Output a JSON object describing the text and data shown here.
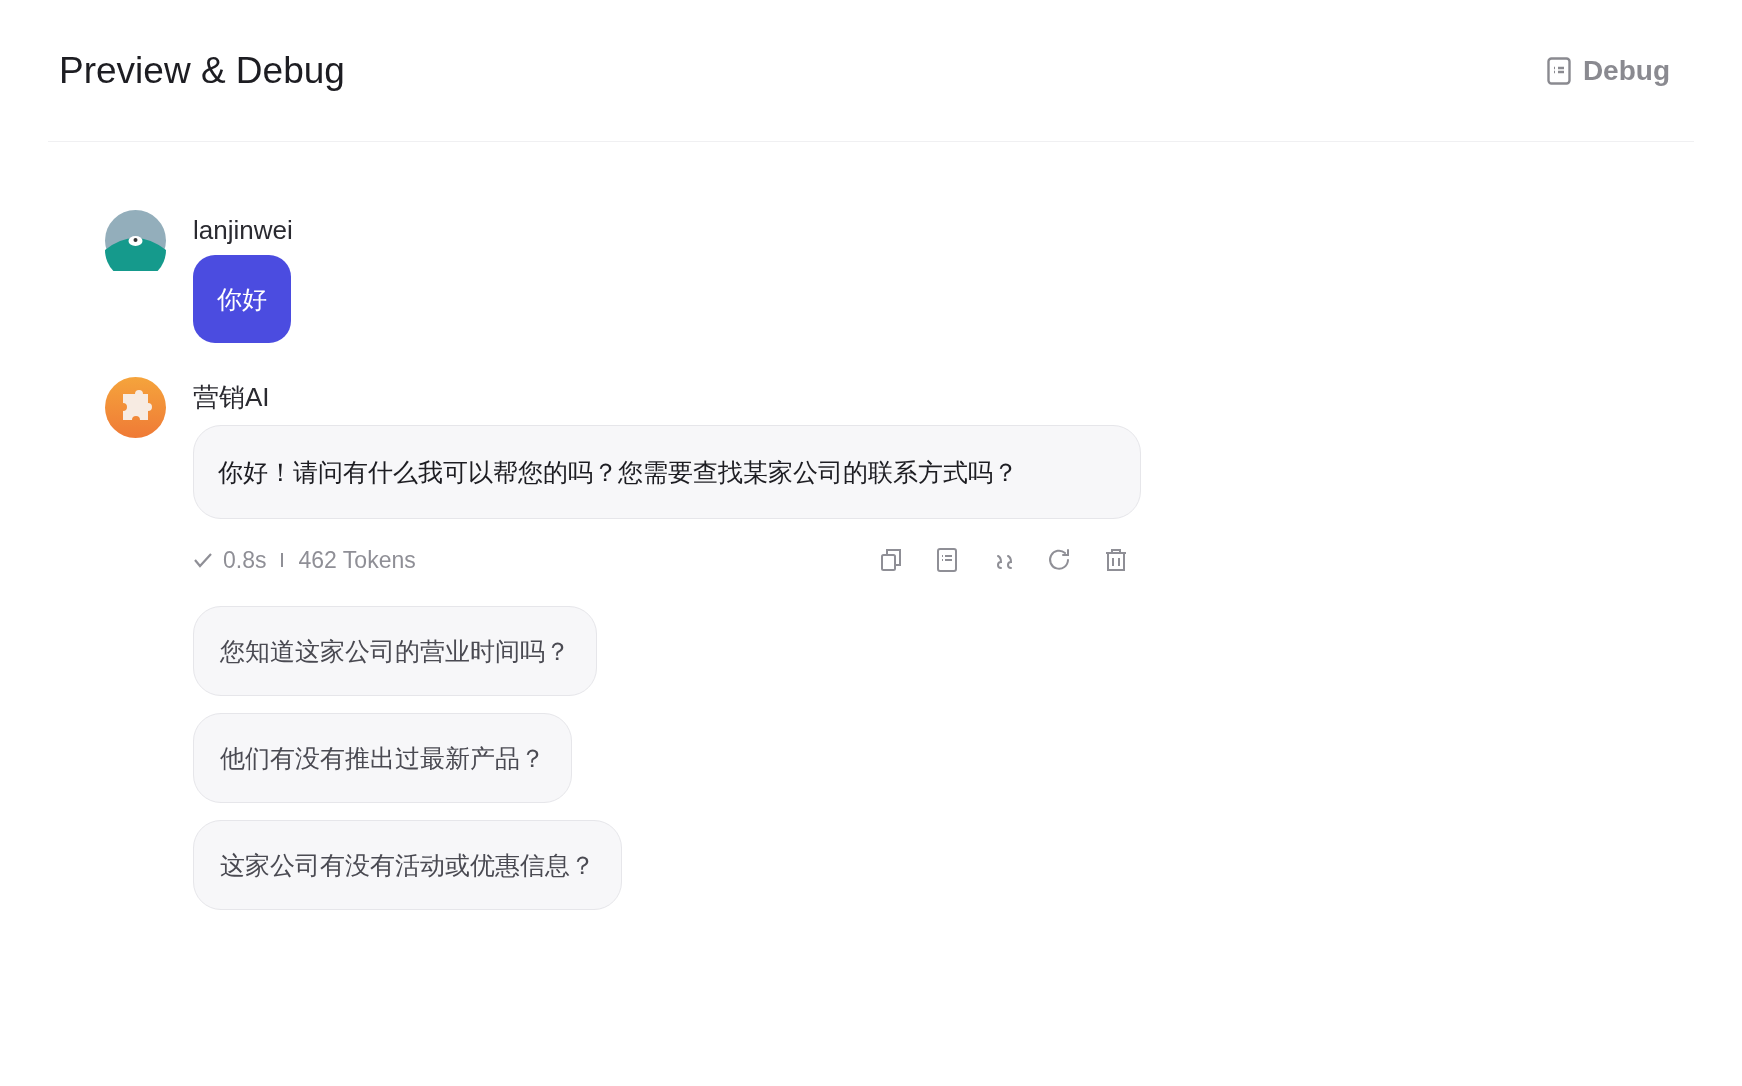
{
  "header": {
    "title": "Preview & Debug",
    "debug_button": "Debug"
  },
  "messages": [
    {
      "kind": "user",
      "author": "lanjinwei",
      "text": "你好"
    },
    {
      "kind": "bot",
      "author": "营销AI",
      "text": "你好！请问有什么我可以帮您的吗？您需要查找某家公司的联系方式吗？",
      "meta": {
        "time": "0.8s",
        "tokens": "462 Tokens"
      }
    }
  ],
  "suggestions": [
    "您知道这家公司的营业时间吗？",
    "他们有没有推出过最新产品？",
    "这家公司有没有活动或优惠信息？"
  ]
}
